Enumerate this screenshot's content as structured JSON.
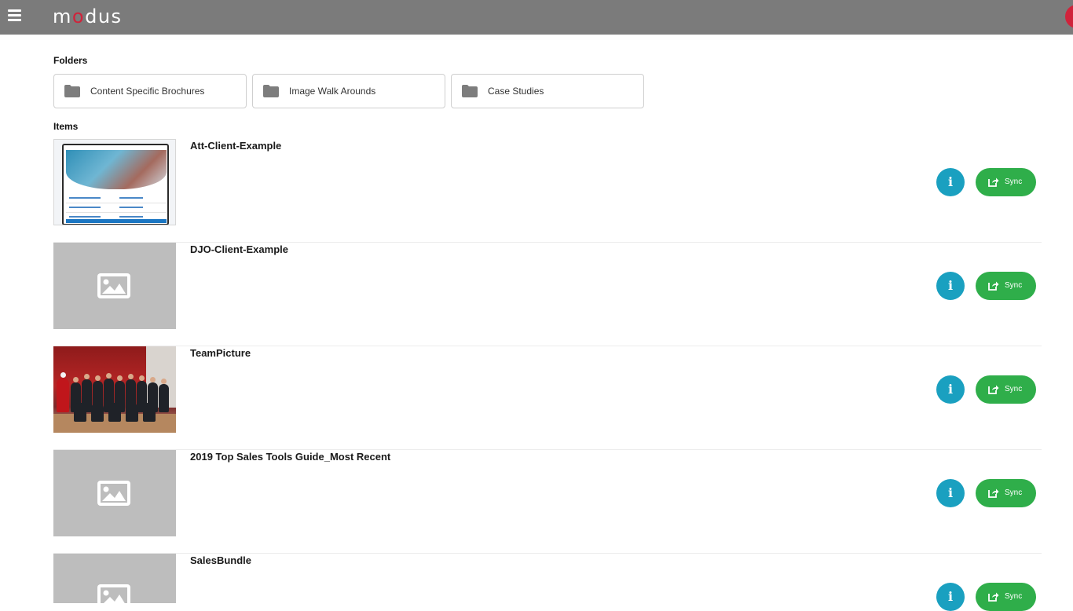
{
  "header": {
    "logo_left": "m",
    "logo_accent": "o",
    "logo_right": "dus"
  },
  "folders": {
    "heading": "Folders",
    "items": [
      {
        "label": "Content Specific Brochures"
      },
      {
        "label": "Image Walk Arounds"
      },
      {
        "label": "Case Studies"
      }
    ]
  },
  "items": {
    "heading": "Items",
    "info_label": "i",
    "sync_label": "Sync",
    "list": [
      {
        "title": "Att-Client-Example",
        "thumbnail": "att-app-screenshot"
      },
      {
        "title": "DJO-Client-Example",
        "thumbnail": "placeholder-image-icon"
      },
      {
        "title": "TeamPicture",
        "thumbnail": "team-photo"
      },
      {
        "title": "2019 Top Sales Tools Guide_Most Recent",
        "thumbnail": "placeholder-image-icon"
      },
      {
        "title": "SalesBundle",
        "thumbnail": "placeholder-image-icon"
      }
    ]
  },
  "colors": {
    "header_bg": "#7b7b7b",
    "brand_red": "#d0233b",
    "info_blue": "#1aa0c0",
    "sync_green": "#2fae4a",
    "placeholder_gray": "#bdbdbd"
  }
}
